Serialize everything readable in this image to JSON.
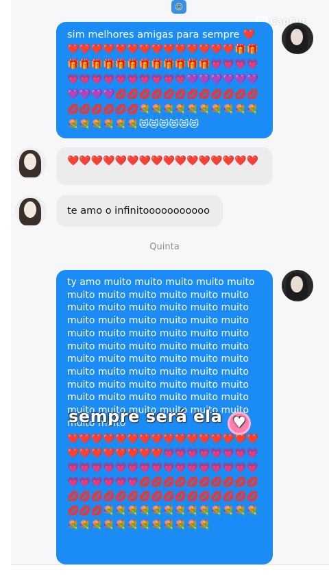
{
  "top_badge_icon": "app-emoji-icon",
  "watermark": "CapCut",
  "messages": [
    {
      "id": "m1",
      "direction": "sent",
      "text": "sim melhores amigas para sempre ❤️",
      "emoji_block": "❤️❤️❤️❤️❤️❤️❤️❤️❤️❤️❤️❤️❤️❤️🎁🎁🎁🎁🎁🎁🎁🎁🎁🎁🎁🎁🎁🎁💗💗💗💗💗💗💗💗💗💗💗💗💗💗💜💜💜💜💜💜💜💜💜💜💋💋💋💋💋💋💋💋💋💋💋💋💋💋💋💋💋💋💐💐💐💐💐💐💐💐💐💐💐💐💐💐💐💐😻😻😻😻😻😻"
    },
    {
      "id": "m2",
      "direction": "received",
      "text": "❤️❤️❤️❤️❤️❤️❤️❤️❤️❤️❤️❤️❤️❤️❤️❤️"
    },
    {
      "id": "m3",
      "direction": "received",
      "text": "te amo o infinitooooooooooo"
    },
    {
      "id": "m4",
      "direction": "sent",
      "text": "ty amo muito muito muito muito muito muito muito muito muito muito muito muito muito muito muito muito muito muito muito muito muito muito muito muito muito muito muito muito muito muito muito muito muito muito muito muito muito muito muito muito muito muito muito muito muito muito muito muito muito muito muito muito muito muito muito muito muito muito muito muito muito muito muito muito muito muito muito",
      "emoji_block": "❤️❤️❤️❤️❤️❤️❤️❤️❤️❤️❤️❤️❤️❤️❤️❤️❤️❤️❤️❤️❤️❤️❤️❤️💗💗💗💗💗💗💗💗💗💗💗💗💗💗💗💗💗💗💗💗💗💗💗💗💗💗💗💗💗💗💋💋💋💋💋💋💋💋💋💋💋💋💋💋💋💋💋💋💋💋💋💋💋💋💋💋💋💋💋💐💐💐💐💐💐💐💐💐💐💐💐💐💐💐💐💐💐💐💐💐💐💐💐💐"
    }
  ],
  "day_separator": "Quinta",
  "sticker_text": "sempre será ela",
  "sticker_icon": "pink-heart-icon",
  "colors": {
    "sent_bubble": "#1b8cf5",
    "received_bubble": "#ececef",
    "background": "#f7f7f9"
  }
}
